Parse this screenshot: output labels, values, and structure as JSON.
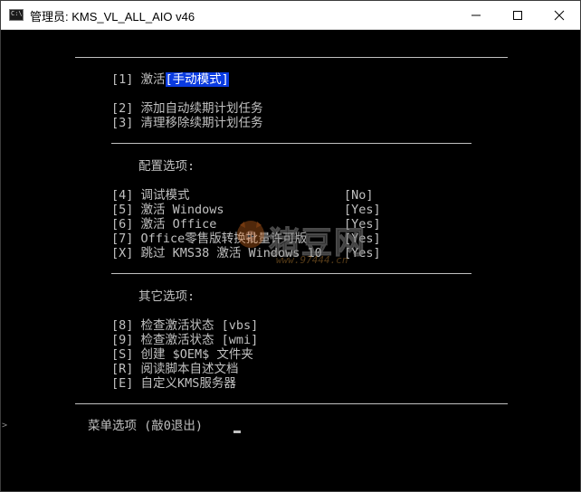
{
  "window": {
    "title": "管理员:  KMS_VL_ALL_AIO v46",
    "icon_text": "C:\\."
  },
  "menu": {
    "item1_key": "[1]",
    "item1_label_prefix": "激活",
    "item1_label_highlight": "[手动模式]",
    "item2": "[2] 添加自动续期计划任务",
    "item3": "[3] 清理移除续期计划任务",
    "config_header": "配置选项:",
    "config": [
      {
        "label": "[4] 调试模式",
        "value": "[No]"
      },
      {
        "label": "[5] 激活 Windows",
        "value": "[Yes]"
      },
      {
        "label": "[6] 激活 Office",
        "value": "[Yes]"
      },
      {
        "label": "[7] Office零售版转换批量许可版",
        "value": "[Yes]"
      },
      {
        "label": "[X] 跳过 KMS38 激活 Windows 10",
        "value": "[Yes]"
      }
    ],
    "other_header": "其它选项:",
    "other": [
      "[8] 检查激活状态 [vbs]",
      "[9] 检查激活状态 [wmi]",
      "[S] 创建 $OEM$ 文件夹",
      "[R] 阅读脚本自述文档",
      "[E] 自定义KMS服务器"
    ],
    "prompt": "菜单选项 (敲0退出) "
  },
  "watermark": {
    "brand": "猪豆网",
    "url": "www.97444.cn"
  },
  "colors": {
    "background": "#000000",
    "text": "#c0c0c0",
    "highlight": "#0a3be0"
  }
}
